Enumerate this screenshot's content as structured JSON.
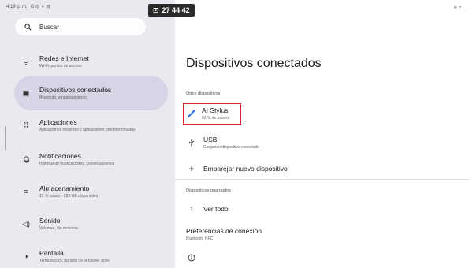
{
  "status_bar": {
    "time": "4:19 p. m.",
    "icons": "G ⊙ ✦ ⊟",
    "right": "✲ ▾"
  },
  "recording_timer": {
    "icon": "⊡",
    "text": "27 44 42"
  },
  "search": {
    "placeholder": "Buscar"
  },
  "sidebar": {
    "items": [
      {
        "icon": "wifi-icon",
        "glyph": "ᯤ",
        "title": "Redes e Internet",
        "subtitle": "Wi-Fi, puntos de acceso"
      },
      {
        "icon": "devices-icon",
        "glyph": "▣",
        "title": "Dispositivos conectados",
        "subtitle": "Bluetooth, emparejamiento",
        "active": true
      },
      {
        "icon": "apps-icon",
        "glyph": "⠿",
        "title": "Aplicaciones",
        "subtitle": "Aplicaciones recientes y aplicaciones predeterminadas"
      },
      {
        "icon": "bell-icon",
        "glyph": "♫",
        "title": "Notificaciones",
        "subtitle": "Historial de notificaciones, conversaciones"
      },
      {
        "icon": "storage-icon",
        "glyph": "≡",
        "title": "Almacenamiento",
        "subtitle": "12 % usado - 225 GB disponibles"
      },
      {
        "icon": "sound-icon",
        "glyph": "◁)",
        "title": "Sonido",
        "subtitle": "Volumen, No molestar"
      },
      {
        "icon": "display-icon",
        "glyph": "◑",
        "title": "Pantalla",
        "subtitle": "Tema oscuro, tamaño de la fuente, brillo"
      }
    ]
  },
  "main": {
    "title": "Dispositivos conectados",
    "other_devices_label": "Otros dispositivos",
    "stylus": {
      "icon": "stylus-icon",
      "title": "AI Stylus",
      "subtitle": "93 % de batería"
    },
    "usb": {
      "icon": "usb-icon",
      "title": "USB",
      "subtitle": "Cargando dispositivo conectado"
    },
    "pair": {
      "icon": "plus-icon",
      "title": "Emparejar nuevo dispositivo"
    },
    "saved_devices_label": "Dispositivos guardados",
    "see_all": {
      "icon": "chevron-right-icon",
      "title": "Ver todo"
    },
    "connection_prefs": {
      "title": "Preferencias de conexión",
      "subtitle": "Bluetooth, NFC"
    },
    "info_icon": "info-icon"
  },
  "colors": {
    "accent_active": "#d8d4e6",
    "highlight": "#e02424",
    "stylus": "#1a73e8"
  }
}
